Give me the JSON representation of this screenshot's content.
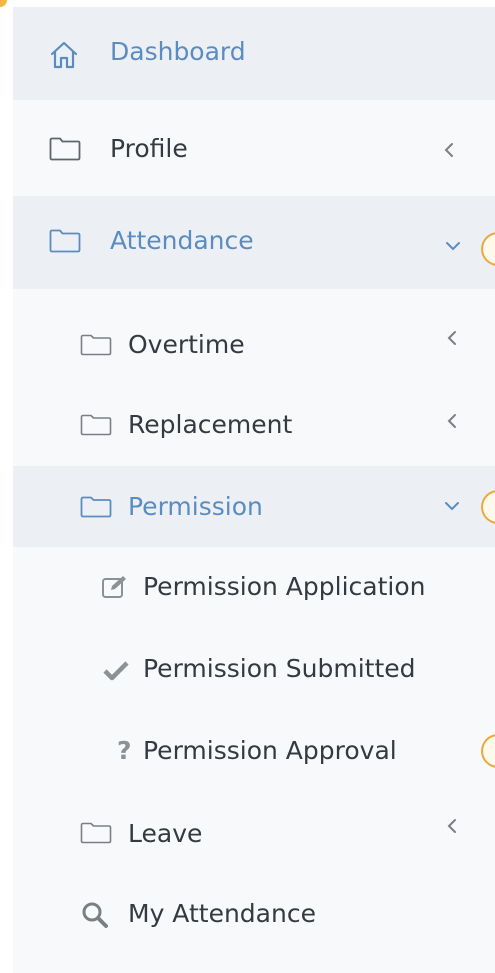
{
  "menu": {
    "dashboard": {
      "label": "Dashboard",
      "icon": "home-icon"
    },
    "profile": {
      "label": "Profile",
      "icon": "folder-icon",
      "chevron": "chevron-left-icon"
    },
    "attendance": {
      "label": "Attendance",
      "icon": "folder-icon",
      "chevron": "chevron-down-icon",
      "children": {
        "overtime": {
          "label": "Overtime",
          "icon": "folder-icon",
          "chevron": "chevron-left-icon"
        },
        "replacement": {
          "label": "Replacement",
          "icon": "folder-icon",
          "chevron": "chevron-left-icon"
        },
        "permission": {
          "label": "Permission",
          "icon": "folder-icon",
          "chevron": "chevron-down-icon",
          "children": {
            "application": {
              "label": "Permission Application",
              "icon": "edit-icon"
            },
            "submitted": {
              "label": "Permission Submitted",
              "icon": "check-icon"
            },
            "approval": {
              "label": "Permission Approval",
              "icon": "question-icon"
            }
          }
        },
        "leave": {
          "label": "Leave",
          "icon": "folder-icon",
          "chevron": "chevron-left-icon"
        },
        "my_attendance": {
          "label": "My Attendance",
          "icon": "search-icon"
        }
      }
    }
  },
  "colors": {
    "accent": "#5b8cc1",
    "text": "#333a40",
    "active_bg": "#ecf0f4",
    "sidebar_bg": "#f8f9fb",
    "badge": "#e8a93f"
  }
}
